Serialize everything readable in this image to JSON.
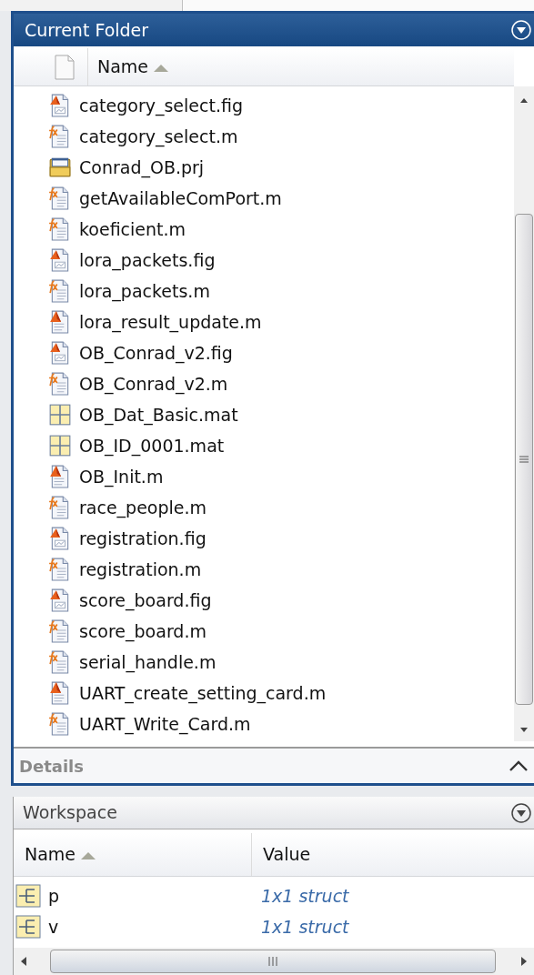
{
  "current_folder": {
    "title": "Current Folder",
    "columns": [
      {
        "label": "Name",
        "sorted": true
      }
    ],
    "files": [
      {
        "name": "category_select.fig",
        "kind": "fig"
      },
      {
        "name": "category_select.m",
        "kind": "function"
      },
      {
        "name": "Conrad_OB.prj",
        "kind": "project"
      },
      {
        "name": "getAvailableComPort.m",
        "kind": "function"
      },
      {
        "name": "koeficient.m",
        "kind": "function"
      },
      {
        "name": "lora_packets.fig",
        "kind": "fig"
      },
      {
        "name": "lora_packets.m",
        "kind": "function"
      },
      {
        "name": "lora_result_update.m",
        "kind": "script"
      },
      {
        "name": "OB_Conrad_v2.fig",
        "kind": "fig"
      },
      {
        "name": "OB_Conrad_v2.m",
        "kind": "function"
      },
      {
        "name": "OB_Dat_Basic.mat",
        "kind": "mat"
      },
      {
        "name": "OB_ID_0001.mat",
        "kind": "mat"
      },
      {
        "name": "OB_Init.m",
        "kind": "script"
      },
      {
        "name": "race_people.m",
        "kind": "function"
      },
      {
        "name": "registration.fig",
        "kind": "fig"
      },
      {
        "name": "registration.m",
        "kind": "function"
      },
      {
        "name": "score_board.fig",
        "kind": "fig"
      },
      {
        "name": "score_board.m",
        "kind": "function"
      },
      {
        "name": "serial_handle.m",
        "kind": "function"
      },
      {
        "name": "UART_create_setting_card.m",
        "kind": "script"
      },
      {
        "name": "UART_Write_Card.m",
        "kind": "function"
      }
    ],
    "details": {
      "label": "Details",
      "expanded": false
    }
  },
  "workspace": {
    "title": "Workspace",
    "columns": [
      {
        "label": "Name",
        "sorted": true
      },
      {
        "label": "Value",
        "sorted": false
      }
    ],
    "variables": [
      {
        "name": "p",
        "value": "1x1 struct"
      },
      {
        "name": "v",
        "value": "1x1 struct"
      }
    ]
  }
}
